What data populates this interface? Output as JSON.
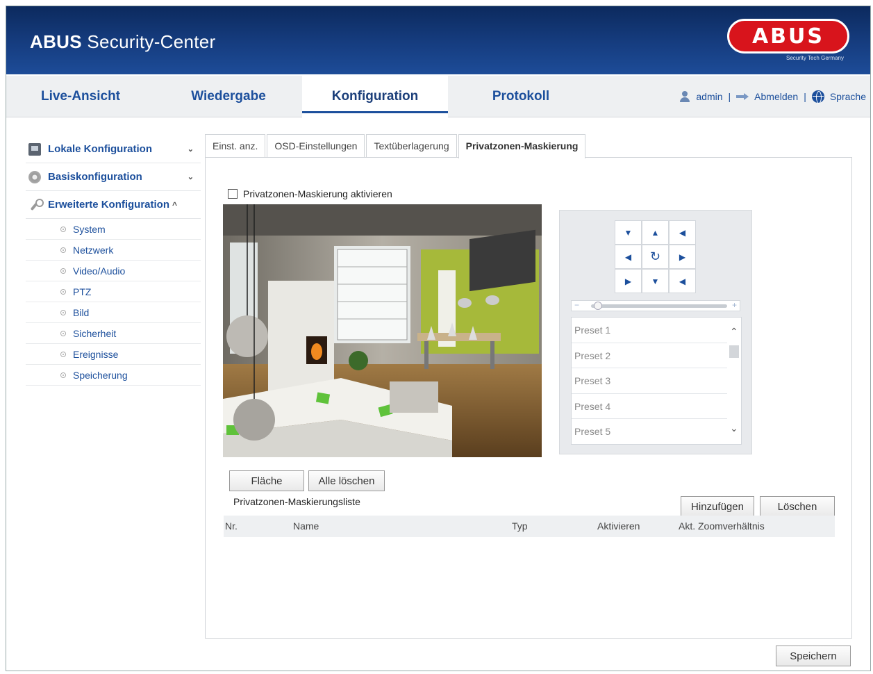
{
  "app": {
    "title_bold": "ABUS",
    "title_rest": " Security-Center",
    "logo_text": "ABUS",
    "logo_sub": "Security Tech Germany",
    "brand_color": "#d8141c",
    "header_color": "#163d80",
    "accent_color": "#1c4f9c"
  },
  "nav": {
    "tabs": [
      {
        "label": "Live-Ansicht"
      },
      {
        "label": "Wiedergabe"
      },
      {
        "label": "Konfiguration",
        "active": true
      },
      {
        "label": "Protokoll"
      }
    ],
    "user": "admin",
    "logout": "Abmelden",
    "language": "Sprache",
    "separator": "|",
    "icons": [
      "user-icon",
      "logout-icon",
      "globe-icon"
    ]
  },
  "sidebar": {
    "sections": [
      {
        "label": "Lokale Konfiguration",
        "chevron": "⌄",
        "icon": "monitor-icon"
      },
      {
        "label": "Basiskonfiguration",
        "chevron": "⌄",
        "icon": "gear-icon"
      },
      {
        "label": "Erweiterte Konfiguration",
        "chevron": "^",
        "icon": "wrench-icon"
      }
    ],
    "items": [
      {
        "label": "System"
      },
      {
        "label": "Netzwerk"
      },
      {
        "label": "Video/Audio"
      },
      {
        "label": "PTZ"
      },
      {
        "label": "Bild"
      },
      {
        "label": "Sicherheit"
      },
      {
        "label": "Ereignisse"
      },
      {
        "label": "Speicherung"
      }
    ]
  },
  "tabs": [
    {
      "label": "Einst. anz."
    },
    {
      "label": "OSD-Einstellungen"
    },
    {
      "label": "Textüberlagerung"
    },
    {
      "label": "Privatzonen-Maskierung",
      "active": true
    }
  ],
  "privacy": {
    "enable_label": "Privatzonen-Maskierung aktivieren",
    "enabled": false
  },
  "ptz": {
    "pad_icons": [
      "▼",
      "▲",
      "◀",
      "◀",
      "↻",
      "▶",
      "▶",
      "▼",
      "◀"
    ],
    "zoom_minus": "−",
    "zoom_plus": "+",
    "zoom_level": 0.05,
    "presets": [
      "Preset 1",
      "Preset 2",
      "Preset 3",
      "Preset 4",
      "Preset 5"
    ],
    "scroll_up": "⌃",
    "scroll_down": "⌄"
  },
  "buttons": {
    "area": "Fläche",
    "clear_all": "Alle löschen",
    "add": "Hinzufügen",
    "delete": "Löschen",
    "save": "Speichern"
  },
  "mask_list": {
    "title": "Privatzonen-Maskierungsliste",
    "columns": [
      "Nr.",
      "Name",
      "Typ",
      "Aktivieren",
      "Akt. Zoomverhältnis"
    ]
  }
}
